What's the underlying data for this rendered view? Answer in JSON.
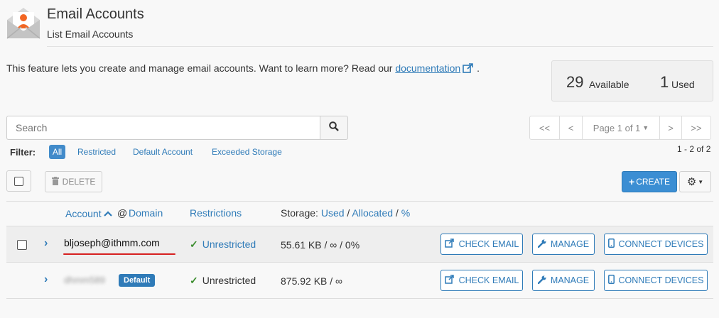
{
  "header": {
    "title": "Email Accounts",
    "subtitle": "List Email Accounts"
  },
  "intro": {
    "text": "This feature lets you create and manage email accounts. Want to learn more? Read our ",
    "link": "documentation",
    "end": "."
  },
  "stats": {
    "available_count": "29",
    "available_label": "Available",
    "used_count": "1",
    "used_label": "Used"
  },
  "search": {
    "placeholder": "Search"
  },
  "pagination": {
    "first": "<<",
    "prev": "<",
    "page": "Page 1 of 1",
    "next": ">",
    "last": ">>",
    "range": "1 - 2 of 2"
  },
  "filter": {
    "label": "Filter:",
    "options": [
      "All",
      "Restricted",
      "Default Account",
      "Exceeded Storage"
    ]
  },
  "toolbar": {
    "delete": "DELETE",
    "create": "CREATE"
  },
  "columns": {
    "account": "Account",
    "at": "@",
    "domain": "Domain",
    "restrictions": "Restrictions",
    "storage": "Storage:",
    "used": "Used",
    "allocated": "Allocated",
    "percent": "%",
    "sep": "/"
  },
  "rows": [
    {
      "account": "bljoseph@ithmm.com",
      "restriction": "Unrestricted",
      "storage": "55.61 KB / ∞ / 0%",
      "actions": [
        "CHECK EMAIL",
        "MANAGE",
        "CONNECT DEVICES"
      ]
    },
    {
      "account": "dhmm589",
      "badge": "Default",
      "restriction": "Unrestricted",
      "storage": "875.92 KB / ∞",
      "actions": [
        "CHECK EMAIL",
        "MANAGE",
        "CONNECT DEVICES"
      ]
    }
  ],
  "colors": {
    "accent": "#2f7bb8",
    "create_bg": "#3b8ed3",
    "underline": "#d62020",
    "check": "#3c8d2f"
  }
}
